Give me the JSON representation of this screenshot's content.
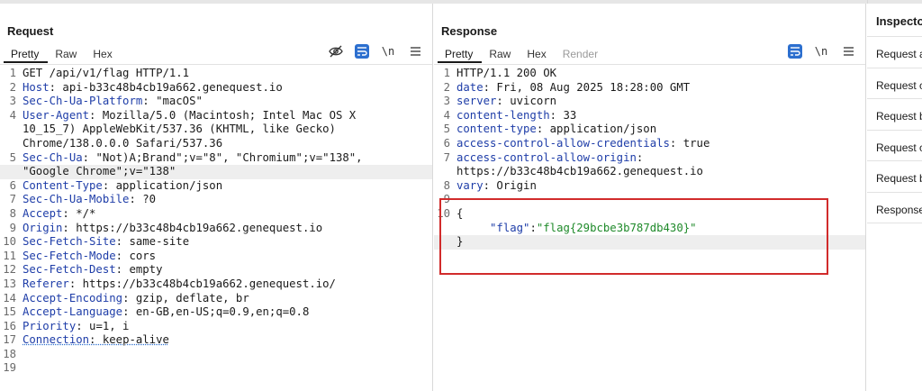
{
  "request": {
    "title": "Request",
    "tabs": [
      "Pretty",
      "Raw",
      "Hex"
    ],
    "newline_label": "\\n",
    "lines": [
      {
        "n": "1",
        "parts": [
          {
            "t": "GET /api/v1/flag HTTP/1.1",
            "c": "s"
          }
        ]
      },
      {
        "n": "2",
        "parts": [
          {
            "t": "Host",
            "c": "k"
          },
          {
            "t": ": api-b33c48b4cb19a662.genequest.io",
            "c": "s"
          }
        ]
      },
      {
        "n": "3",
        "parts": [
          {
            "t": "Sec-Ch-Ua-Platform",
            "c": "k"
          },
          {
            "t": ": \"macOS\"",
            "c": "s"
          }
        ]
      },
      {
        "n": "4",
        "parts": [
          {
            "t": "User-Agent",
            "c": "k"
          },
          {
            "t": ": Mozilla/5.0 (Macintosh; Intel Mac OS X",
            "c": "s"
          }
        ]
      },
      {
        "n": "",
        "parts": [
          {
            "t": "10_15_7) AppleWebKit/537.36 (KHTML, like Gecko)",
            "c": "s"
          }
        ]
      },
      {
        "n": "",
        "parts": [
          {
            "t": "Chrome/138.0.0.0 Safari/537.36",
            "c": "s"
          }
        ]
      },
      {
        "n": "5",
        "parts": [
          {
            "t": "Sec-Ch-Ua",
            "c": "k"
          },
          {
            "t": ": \"Not)A;Brand\";v=\"8\", \"Chromium\";v=\"138\",",
            "c": "s"
          }
        ]
      },
      {
        "n": "",
        "hl": true,
        "parts": [
          {
            "t": "\"Google Chrome\";v=\"138\"",
            "c": "s"
          }
        ]
      },
      {
        "n": "6",
        "parts": [
          {
            "t": "Content-Type",
            "c": "k"
          },
          {
            "t": ": application/json",
            "c": "s"
          }
        ]
      },
      {
        "n": "7",
        "parts": [
          {
            "t": "Sec-Ch-Ua-Mobile",
            "c": "k"
          },
          {
            "t": ": ?0",
            "c": "s"
          }
        ]
      },
      {
        "n": "8",
        "parts": [
          {
            "t": "Accept",
            "c": "k"
          },
          {
            "t": ": */*",
            "c": "s"
          }
        ]
      },
      {
        "n": "9",
        "parts": [
          {
            "t": "Origin",
            "c": "k"
          },
          {
            "t": ": https://b33c48b4cb19a662.genequest.io",
            "c": "s"
          }
        ]
      },
      {
        "n": "10",
        "parts": [
          {
            "t": "Sec-Fetch-Site",
            "c": "k"
          },
          {
            "t": ": same-site",
            "c": "s"
          }
        ]
      },
      {
        "n": "11",
        "parts": [
          {
            "t": "Sec-Fetch-Mode",
            "c": "k"
          },
          {
            "t": ": cors",
            "c": "s"
          }
        ]
      },
      {
        "n": "12",
        "parts": [
          {
            "t": "Sec-Fetch-Dest",
            "c": "k"
          },
          {
            "t": ": empty",
            "c": "s"
          }
        ]
      },
      {
        "n": "13",
        "parts": [
          {
            "t": "Referer",
            "c": "k"
          },
          {
            "t": ": https://b33c48b4cb19a662.genequest.io/",
            "c": "s"
          }
        ]
      },
      {
        "n": "14",
        "parts": [
          {
            "t": "Accept-Encoding",
            "c": "k"
          },
          {
            "t": ": gzip, deflate, br",
            "c": "s"
          }
        ]
      },
      {
        "n": "15",
        "parts": [
          {
            "t": "Accept-Language",
            "c": "k"
          },
          {
            "t": ": en-GB,en-US;q=0.9,en;q=0.8",
            "c": "s"
          }
        ]
      },
      {
        "n": "16",
        "parts": [
          {
            "t": "Priority",
            "c": "k"
          },
          {
            "t": ": u=1, i",
            "c": "s"
          }
        ]
      },
      {
        "n": "17",
        "parts": [
          {
            "t": "Connection",
            "c": "k u"
          },
          {
            "t": ": keep-alive",
            "c": "s u"
          }
        ]
      },
      {
        "n": "18",
        "parts": []
      },
      {
        "n": "19",
        "parts": []
      }
    ]
  },
  "response": {
    "title": "Response",
    "tabs": [
      "Pretty",
      "Raw",
      "Hex",
      "Render"
    ],
    "newline_label": "\\n",
    "lines": [
      {
        "n": "1",
        "parts": [
          {
            "t": "HTTP/1.1 200 OK",
            "c": "s"
          }
        ]
      },
      {
        "n": "2",
        "parts": [
          {
            "t": "date",
            "c": "k"
          },
          {
            "t": ": Fri, 08 Aug 2025 18:28:00 GMT",
            "c": "s"
          }
        ]
      },
      {
        "n": "3",
        "parts": [
          {
            "t": "server",
            "c": "k"
          },
          {
            "t": ": uvicorn",
            "c": "s"
          }
        ]
      },
      {
        "n": "4",
        "parts": [
          {
            "t": "content-length",
            "c": "k"
          },
          {
            "t": ": 33",
            "c": "s"
          }
        ]
      },
      {
        "n": "5",
        "parts": [
          {
            "t": "content-type",
            "c": "k"
          },
          {
            "t": ": application/json",
            "c": "s"
          }
        ]
      },
      {
        "n": "6",
        "parts": [
          {
            "t": "access-control-allow-credentials",
            "c": "k"
          },
          {
            "t": ": true",
            "c": "s"
          }
        ]
      },
      {
        "n": "7",
        "parts": [
          {
            "t": "access-control-allow-origin",
            "c": "k"
          },
          {
            "t": ":",
            "c": "s"
          }
        ]
      },
      {
        "n": "",
        "parts": [
          {
            "t": "https://b33c48b4cb19a662.genequest.io",
            "c": "s"
          }
        ]
      },
      {
        "n": "8",
        "parts": [
          {
            "t": "vary",
            "c": "k"
          },
          {
            "t": ": Origin",
            "c": "s"
          }
        ]
      },
      {
        "n": "9",
        "parts": []
      },
      {
        "n": "10",
        "parts": [
          {
            "t": "{",
            "c": "s"
          }
        ]
      },
      {
        "n": "",
        "parts": [
          {
            "t": "     ",
            "c": "s"
          },
          {
            "t": "\"flag\"",
            "c": "v-key"
          },
          {
            "t": ":",
            "c": "s"
          },
          {
            "t": "\"flag{29bcbe3b787db430}\"",
            "c": "v-str"
          }
        ]
      },
      {
        "n": "",
        "hl": true,
        "parts": [
          {
            "t": "}",
            "c": "s"
          }
        ]
      }
    ]
  },
  "inspector": {
    "title": "Inspecto",
    "items": [
      "Request a",
      "Request c",
      "Request b",
      "Request c",
      "Request b",
      "Response"
    ]
  },
  "colors": {
    "accent": "#2c6fcf",
    "header_key": "#1e3da8",
    "json_string": "#1f8a2a",
    "highlight_box": "#d12b2b"
  }
}
